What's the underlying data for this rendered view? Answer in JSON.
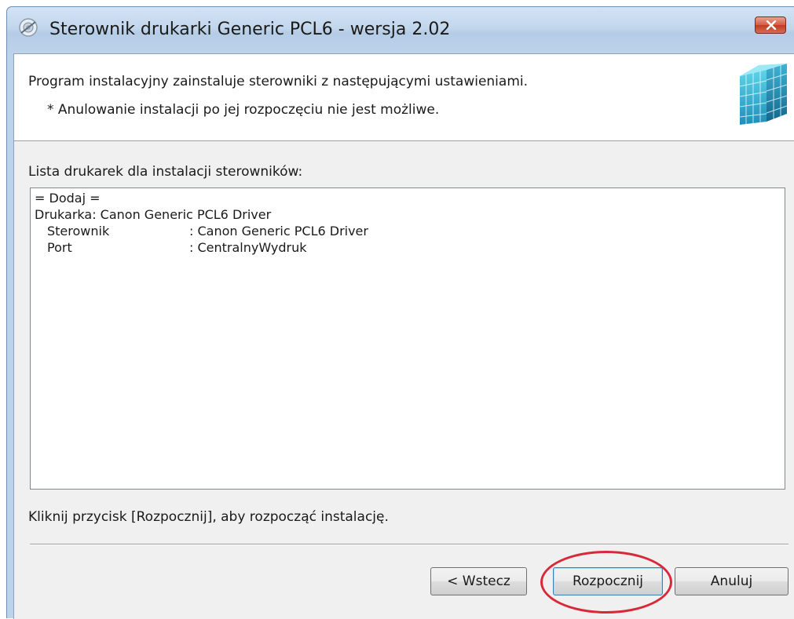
{
  "window": {
    "title": "Sterownik drukarki Generic PCL6 - wersja 2.02"
  },
  "header": {
    "line1": "Program instalacyjny zainstaluje sterowniki z następującymi ustawieniami.",
    "line2": "* Anulowanie instalacji po jej rozpoczęciu nie jest możliwe."
  },
  "list": {
    "label": "Lista drukarek dla instalacji sterowników:",
    "action": "= Dodaj =",
    "printer": "Drukarka: Canon Generic PCL6 Driver",
    "rows": [
      {
        "key": "Sterownik",
        "value": ": Canon Generic PCL6 Driver"
      },
      {
        "key": "Port",
        "value": ": CentralnyWydruk"
      }
    ]
  },
  "footer": {
    "instruction": "Kliknij przycisk [Rozpocznij], aby rozpocząć instalację."
  },
  "buttons": {
    "back": "< Wstecz",
    "start": "Rozpocznij",
    "cancel": "Anuluj"
  },
  "colors": {
    "highlight_ring": "#d8283a",
    "close_button": "#c13c24"
  },
  "icons": {
    "app": "printer-driver-icon",
    "close": "close-icon",
    "header_graphic": "cube-icon"
  }
}
